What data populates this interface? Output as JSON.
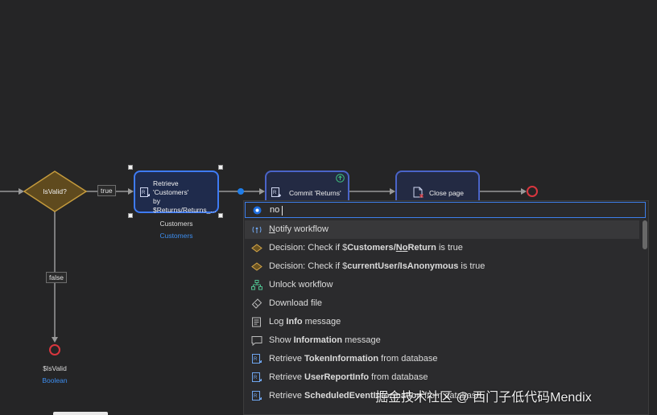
{
  "flow": {
    "decision_label": "IsValid?",
    "true_label": "true",
    "false_label": "false",
    "retrieve": {
      "line1": "Retrieve 'Customers'",
      "line2": "by",
      "line3": "$Returns/Returns_...",
      "caption_name": "Customers",
      "caption_type": "Customers"
    },
    "commit_label": "Commit 'Returns'",
    "close_label": "Close page",
    "end_caption_name": "$IsValid",
    "end_caption_type": "Boolean"
  },
  "search": {
    "value": "no"
  },
  "suggestions": [
    {
      "icon": "notify-workflow-icon",
      "parts": [
        {
          "t": "N",
          "u": true
        },
        {
          "t": "otify workflow"
        }
      ]
    },
    {
      "icon": "decision-icon",
      "parts": [
        {
          "t": "Decision: Check if $"
        },
        {
          "t": "Customers",
          "b": true
        },
        {
          "t": "/",
          "b": true
        },
        {
          "t": "N",
          "b": true,
          "u": true
        },
        {
          "t": "o",
          "b": true,
          "u": true
        },
        {
          "t": "Return",
          "b": true
        },
        {
          "t": " is true"
        }
      ]
    },
    {
      "icon": "decision-icon",
      "parts": [
        {
          "t": "Decision: Check if $"
        },
        {
          "t": "currentUser/IsAnonymous",
          "b": true
        },
        {
          "t": " is true"
        }
      ]
    },
    {
      "icon": "unlock-workflow-icon",
      "parts": [
        {
          "t": "Unlock workflow"
        }
      ]
    },
    {
      "icon": "download-file-icon",
      "parts": [
        {
          "t": "Download file"
        }
      ]
    },
    {
      "icon": "log-message-icon",
      "parts": [
        {
          "t": "Log "
        },
        {
          "t": "Info",
          "b": true
        },
        {
          "t": " message"
        }
      ]
    },
    {
      "icon": "show-message-icon",
      "parts": [
        {
          "t": "Show "
        },
        {
          "t": "Information",
          "b": true
        },
        {
          "t": " message"
        }
      ]
    },
    {
      "icon": "retrieve-icon",
      "parts": [
        {
          "t": "Retrieve "
        },
        {
          "t": "TokenInformation",
          "b": true
        },
        {
          "t": " from database"
        }
      ]
    },
    {
      "icon": "retrieve-icon",
      "parts": [
        {
          "t": "Retrieve "
        },
        {
          "t": "UserReportInfo",
          "b": true
        },
        {
          "t": " from database"
        }
      ]
    },
    {
      "icon": "retrieve-icon",
      "parts": [
        {
          "t": "Retrieve "
        },
        {
          "t": "ScheduledEventInformation",
          "b": true
        },
        {
          "t": " from database"
        }
      ]
    }
  ],
  "watermark": "掘金技术社区 @ 西门子低代码Mendix",
  "colors": {
    "canvas": "#252526",
    "accent": "#3d7eea",
    "decision_fill": "#6b5320",
    "decision_border": "#c49a3c",
    "end_event": "#d9363e",
    "link_blue": "#3d8ef0"
  }
}
